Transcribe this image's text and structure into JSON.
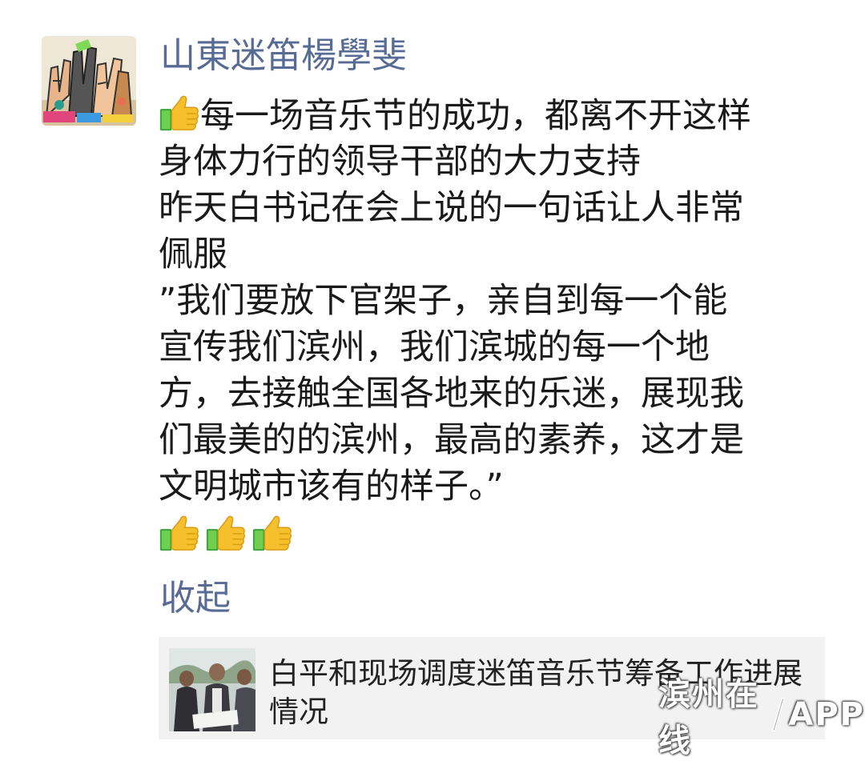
{
  "post": {
    "author": "山東迷笛楊學斐",
    "avatar_icon": "collage-avatar-icon",
    "lines": [
      "每一场音乐节的成功，都离不开这样",
      "身体力行的领导干部的大力支持",
      "昨天白书记在会上说的一句话让人非常",
      "佩服",
      "”我们要放下官架子，亲自到每一个能",
      "宣传我们滨州，我们滨城的每一个地",
      "方，去接触全国各地来的乐迷，展现我",
      "们最美的的滨州，最高的素养，这才是",
      "文明城市该有的样子。”"
    ],
    "emoji_icon": "thumbs-up-icon",
    "trailing_emoji_count": 3,
    "collapse_label": "收起"
  },
  "link_card": {
    "title": "白平和现场调度迷笛音乐节筹备工作进展情况",
    "thumbnail_icon": "news-photo-thumbnail"
  },
  "watermark": {
    "text_left": "滨州在线",
    "text_right": "APP"
  },
  "colors": {
    "link_blue": "#576b95",
    "text": "#1a1a1a",
    "card_bg": "#f2f2f2"
  }
}
